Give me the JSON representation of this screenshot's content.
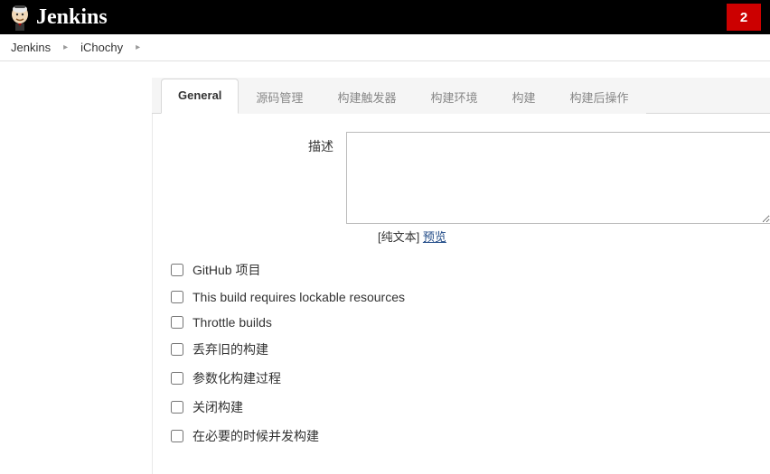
{
  "header": {
    "title": "Jenkins",
    "badge_count": "2"
  },
  "breadcrumbs": {
    "items": [
      "Jenkins",
      "iChochy"
    ]
  },
  "tabs": {
    "items": [
      {
        "label": "General",
        "active": true
      },
      {
        "label": "源码管理",
        "active": false
      },
      {
        "label": "构建触发器",
        "active": false
      },
      {
        "label": "构建环境",
        "active": false
      },
      {
        "label": "构建",
        "active": false
      },
      {
        "label": "构建后操作",
        "active": false
      }
    ]
  },
  "general": {
    "description_label": "描述",
    "description_value": "",
    "plaintext_label": "[纯文本]",
    "preview_label": "预览",
    "checkboxes": [
      {
        "label": "GitHub 项目"
      },
      {
        "label": "This build requires lockable resources"
      },
      {
        "label": "Throttle builds"
      },
      {
        "label": "丢弃旧的构建"
      },
      {
        "label": "参数化构建过程"
      },
      {
        "label": "关闭构建"
      },
      {
        "label": "在必要的时候并发构建"
      }
    ]
  }
}
